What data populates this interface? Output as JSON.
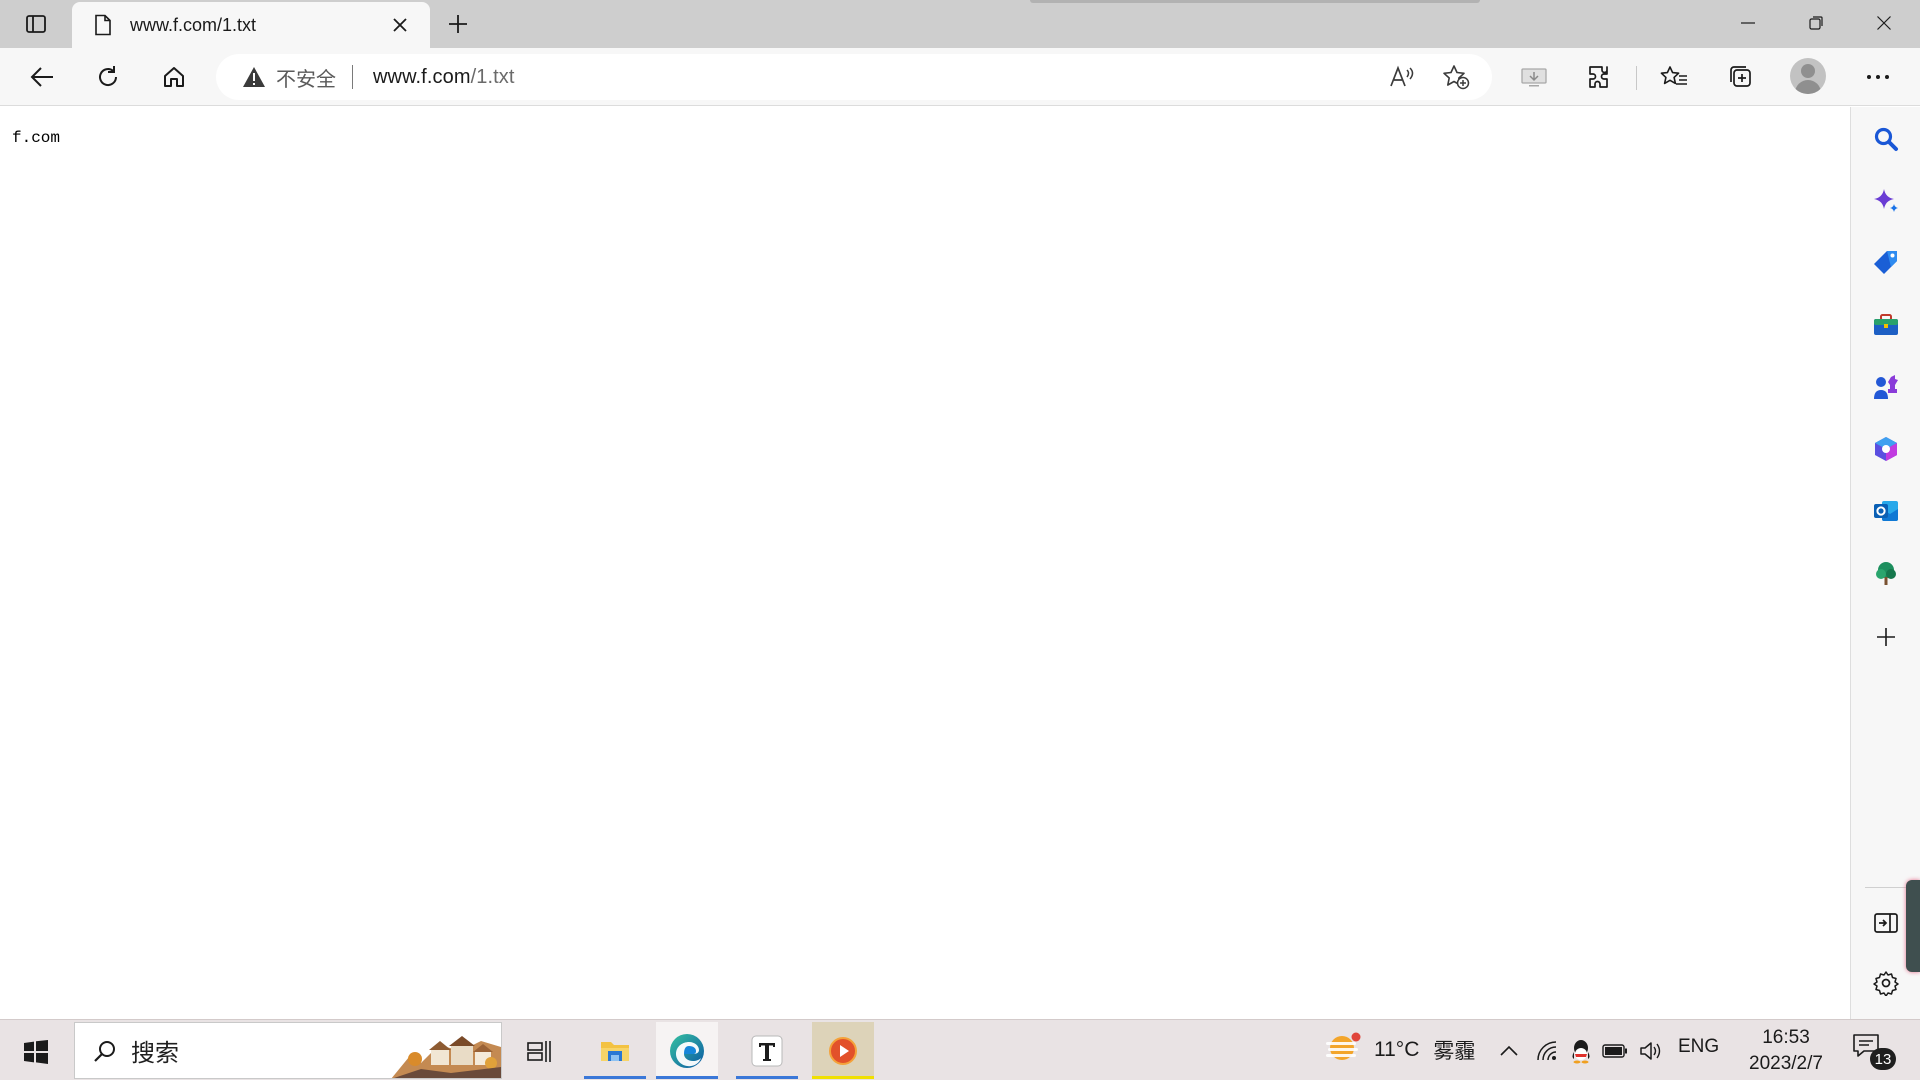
{
  "tab": {
    "title": "www.f.com/1.txt",
    "close_label": "×",
    "new_tab_label": "+"
  },
  "address_bar": {
    "security_label": "不安全",
    "url_host": "www.f.com",
    "url_path": "/1.txt"
  },
  "page": {
    "text": "f.com"
  },
  "taskbar": {
    "search_placeholder": "搜索",
    "weather_temp": "11°C",
    "weather_condition": "雾霾",
    "language": "ENG",
    "time": "16:53",
    "date": "2023/2/7",
    "notification_count": "13"
  },
  "colors": {
    "tabstrip_bg": "#cecece",
    "toolbar_bg": "#f7f7f7",
    "taskbar_bg": "#e9e3e4",
    "taskbar_active_underline": "#3b78d8",
    "sidebar_search": "#1a57d6"
  },
  "icons": {
    "toolbar": [
      "back-icon",
      "refresh-icon",
      "home-icon",
      "warning-icon",
      "read-aloud-icon",
      "add-favorite-icon",
      "screenshot-icon",
      "extensions-icon",
      "favorites-icon",
      "collections-icon",
      "profile-icon",
      "more-icon"
    ],
    "sidebar": [
      "search-icon",
      "copilot-sparkle-icon",
      "shopping-tag-icon",
      "tools-briefcase-icon",
      "games-chess-icon",
      "office-icon",
      "outlook-icon",
      "tree-icon",
      "add-icon",
      "split-screen-icon",
      "settings-icon"
    ]
  }
}
